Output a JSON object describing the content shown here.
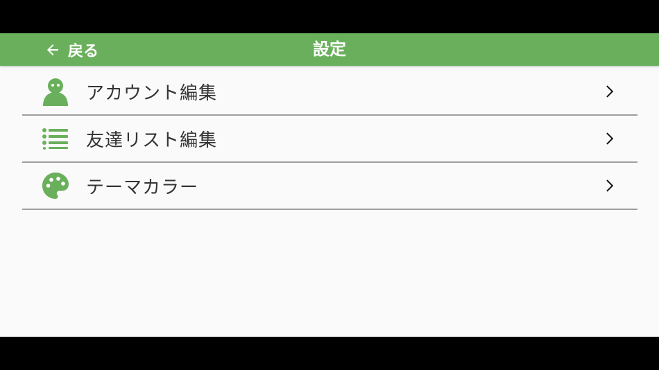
{
  "header": {
    "back_label": "戻る",
    "title": "設定"
  },
  "menu": {
    "items": [
      {
        "label": "アカウント編集",
        "icon": "person-icon"
      },
      {
        "label": "友達リスト編集",
        "icon": "list-icon"
      },
      {
        "label": "テーマカラー",
        "icon": "palette-icon"
      }
    ]
  },
  "colors": {
    "accent": "#6ab05c",
    "background": "#fafafa",
    "divider": "#9e9e9e",
    "text": "#333333"
  }
}
